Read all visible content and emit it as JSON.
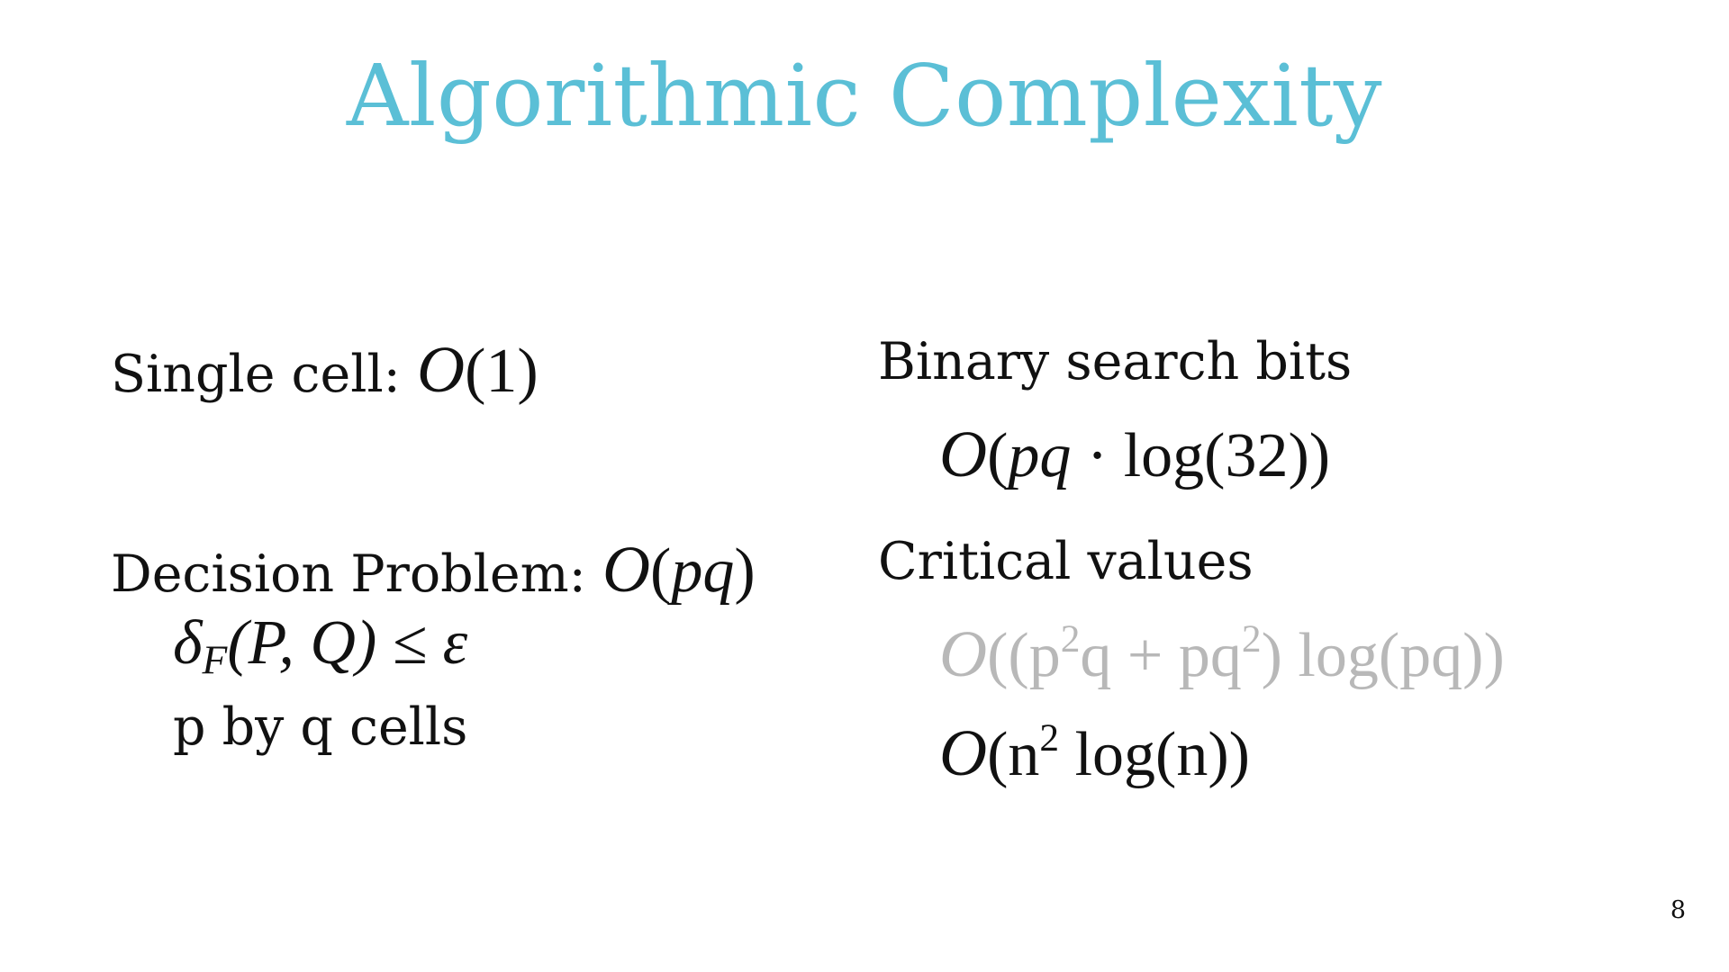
{
  "slide": {
    "title": "Algorithmic Complexity",
    "page_number": "8"
  },
  "left": {
    "single_cell_label": "Single cell: ",
    "single_cell_math": {
      "O": "O",
      "args": "(1)"
    },
    "decision_label": "Decision Problem: ",
    "decision_math": {
      "O": "O",
      "open": "(",
      "pq": "pq",
      "close": ")"
    },
    "condition": {
      "delta": "δ",
      "sub": "F",
      "args": "(P, Q) ≤ ε"
    },
    "cells_text": "p by q cells"
  },
  "right": {
    "binary_label": "Binary search bits",
    "binary_math": {
      "O": "O",
      "open": "(",
      "pq": "pq",
      "rest": " · log(32))"
    },
    "critical_label": "Critical values",
    "critical_math_old": {
      "O": "O",
      "text1": "((p",
      "sup1": "2",
      "text2": "q + pq",
      "sup2": "2",
      "text3": ") log(pq))"
    },
    "critical_math_new": {
      "O": "O",
      "text1": "(n",
      "sup1": "2",
      "text2": " log(n))"
    }
  },
  "colors": {
    "title": "#5bbfd6",
    "text": "#111111",
    "muted": "#b8b8b8"
  }
}
